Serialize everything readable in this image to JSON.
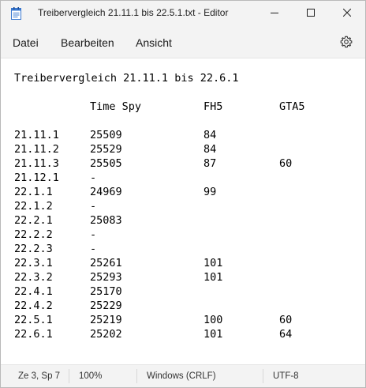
{
  "window": {
    "title": "Treibervergleich 21.11.1 bis 22.5.1.txt - Editor",
    "controls": [
      "minimize",
      "maximize",
      "close"
    ]
  },
  "menu": {
    "file": "Datei",
    "edit": "Bearbeiten",
    "view": "Ansicht"
  },
  "document": {
    "heading": "Treibervergleich 21.11.1 bis 22.6.1",
    "columns": [
      "",
      "Time Spy",
      "FH5",
      "GTA5"
    ],
    "rows": [
      [
        "21.11.1",
        "25509",
        "84",
        ""
      ],
      [
        "21.11.2",
        "25529",
        "84",
        ""
      ],
      [
        "21.11.3",
        "25505",
        "87",
        "60"
      ],
      [
        "21.12.1",
        "-",
        "",
        ""
      ],
      [
        "22.1.1",
        "24969",
        "99",
        ""
      ],
      [
        "22.1.2",
        "-",
        "",
        ""
      ],
      [
        "22.2.1",
        "25083",
        "",
        ""
      ],
      [
        "22.2.2",
        "-",
        "",
        ""
      ],
      [
        "22.2.3",
        "-",
        "",
        ""
      ],
      [
        "22.3.1",
        "25261",
        "101",
        ""
      ],
      [
        "22.3.2",
        "25293",
        "101",
        ""
      ],
      [
        "22.4.1",
        "25170",
        "",
        ""
      ],
      [
        "22.4.2",
        "25229",
        "",
        ""
      ],
      [
        "22.5.1",
        "25219",
        "100",
        "60"
      ],
      [
        "22.6.1",
        "25202",
        "101",
        "64"
      ]
    ]
  },
  "status": {
    "position": "Ze 3, Sp 7",
    "zoom": "100%",
    "line_ending": "Windows (CRLF)",
    "encoding": "UTF-8"
  },
  "icons": {
    "app": "notepad-icon",
    "settings": "gear-icon"
  }
}
